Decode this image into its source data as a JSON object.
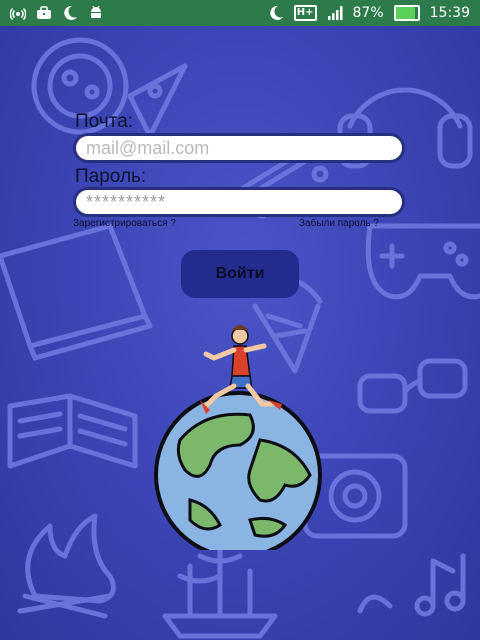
{
  "status_bar": {
    "left_icons": [
      "hotspot-icon",
      "briefcase-icon",
      "moon-icon",
      "android-icon"
    ],
    "right_icons": [
      "moon-icon",
      "network-icon",
      "signal-icon",
      "battery-icon"
    ],
    "network_label": "H+",
    "battery_percent": "87%",
    "battery_level": 0.87,
    "time": "15:39"
  },
  "form": {
    "email_label": "Почта:",
    "email_placeholder": "mail@mail.com",
    "password_label": "Пароль:",
    "password_value": "**********",
    "register_link": "Зарегистрироваться ?",
    "forgot_link": "Забыли пароль ?",
    "login_button": "Войти"
  },
  "colors": {
    "background": "#3b44b4",
    "status_bar": "#2d7a4a",
    "button": "#232b8f",
    "doodle": "#6d78e0"
  }
}
